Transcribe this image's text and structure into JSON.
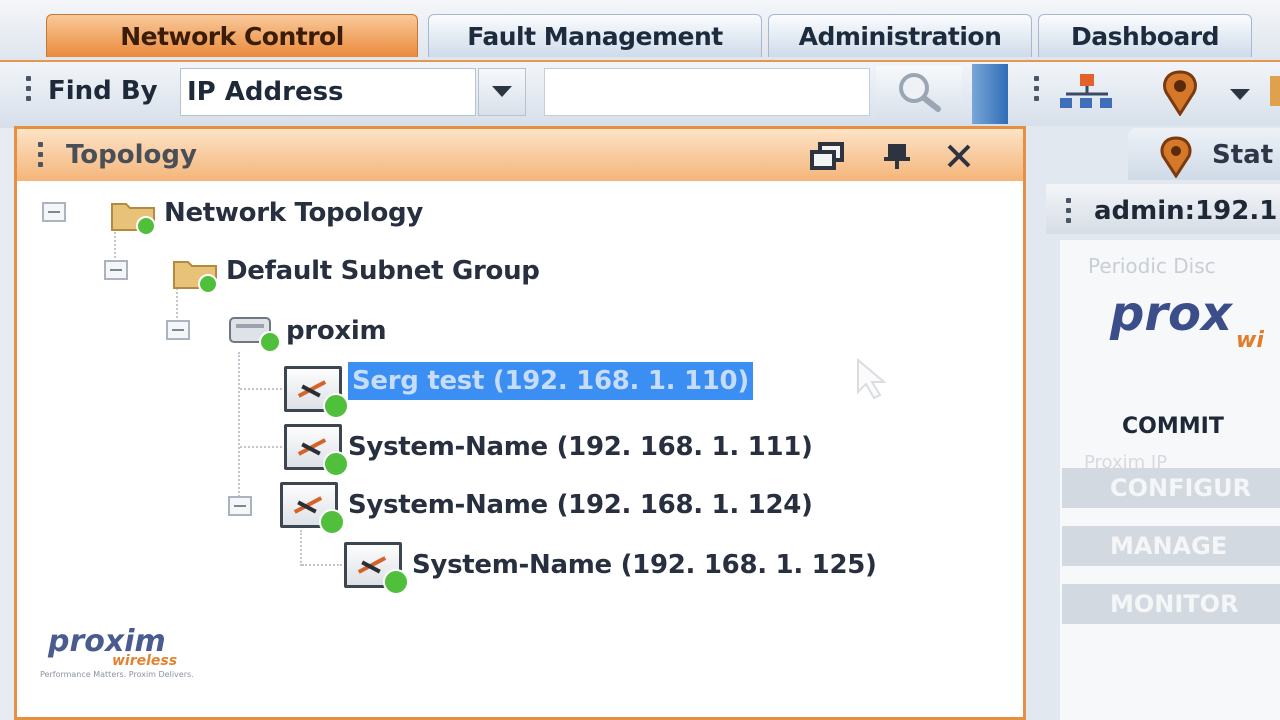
{
  "tabs": {
    "network_control": "Network Control",
    "fault_management": "Fault Management",
    "administration": "Administration",
    "dashboard": "Dashboard"
  },
  "toolbar": {
    "find_by_label": "Find By",
    "find_by_value": "IP Address",
    "search_value": ""
  },
  "topology": {
    "title": "Topology",
    "nodes": {
      "root": "Network Topology",
      "group": "Default Subnet Group",
      "proxim": "proxim",
      "n1": "Serg test (192. 168. 1. 110)",
      "n2": "System-Name (192. 168. 1. 111)",
      "n3": "System-Name (192. 168. 1. 124)",
      "n4": "System-Name (192. 168. 1. 125)"
    }
  },
  "right_panel": {
    "tab_label": "Stat",
    "admin_label": "admin:192.1",
    "periodic_text": "Periodic Disc",
    "logo_text": "prox",
    "logo_sub": "wi",
    "commit_label": "COMMIT",
    "faint_text": "Proxim IP",
    "menu": [
      "CONFIGUR",
      "MANAGE",
      "MONITOR"
    ]
  },
  "branding": {
    "logo": "proxim",
    "logo_sub": "wireless",
    "tagline": "Performance Matters. Proxim Delivers."
  },
  "colors": {
    "accent_orange": "#e98a3c",
    "selection_blue": "#3b8ff2",
    "status_green": "#4fbf3c"
  }
}
